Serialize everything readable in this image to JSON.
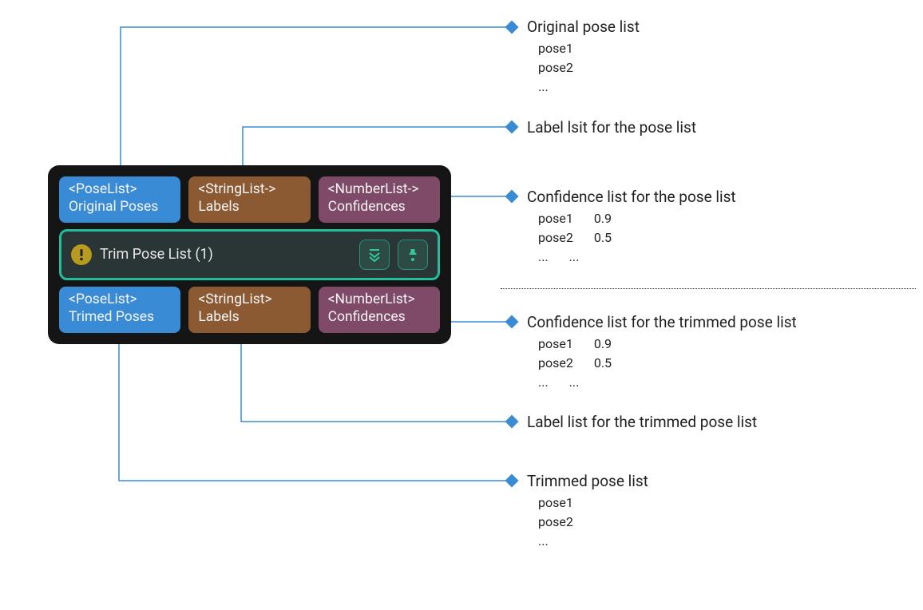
{
  "node": {
    "title": "Trim Pose List (1)",
    "inputs": [
      {
        "type": "<PoseList>",
        "name": "Original Poses",
        "color": "blue"
      },
      {
        "type": "<StringList->",
        "name": "Labels",
        "color": "brown"
      },
      {
        "type": "<NumberList->",
        "name": "Confidences",
        "color": "plum"
      }
    ],
    "outputs": [
      {
        "type": "<PoseList>",
        "name": "Trimed Poses",
        "color": "blue"
      },
      {
        "type": "<StringList>",
        "name": "Labels",
        "color": "brown"
      },
      {
        "type": "<NumberList>",
        "name": "Confidences",
        "color": "plum"
      }
    ],
    "icons": [
      "expand-down-icon",
      "insert-down-icon"
    ]
  },
  "annotations": {
    "a1": {
      "title": "Original pose list",
      "items": [
        "pose1",
        "pose2",
        "..."
      ]
    },
    "a2": {
      "title": "Label lsit for the pose list"
    },
    "a3": {
      "title": "Confidence list for the pose list",
      "rows": [
        [
          "pose1",
          "0.9"
        ],
        [
          "pose2",
          "0.5"
        ],
        [
          "...",
          "..."
        ]
      ]
    },
    "a4": {
      "title": "Confidence list for the trimmed pose list",
      "rows": [
        [
          "pose1",
          "0.9"
        ],
        [
          "pose2",
          "0.5"
        ],
        [
          "...",
          "..."
        ]
      ]
    },
    "a5": {
      "title": "Label list for the trimmed pose list"
    },
    "a6": {
      "title": "Trimmed pose list",
      "items": [
        "pose1",
        "pose2",
        "..."
      ]
    }
  }
}
